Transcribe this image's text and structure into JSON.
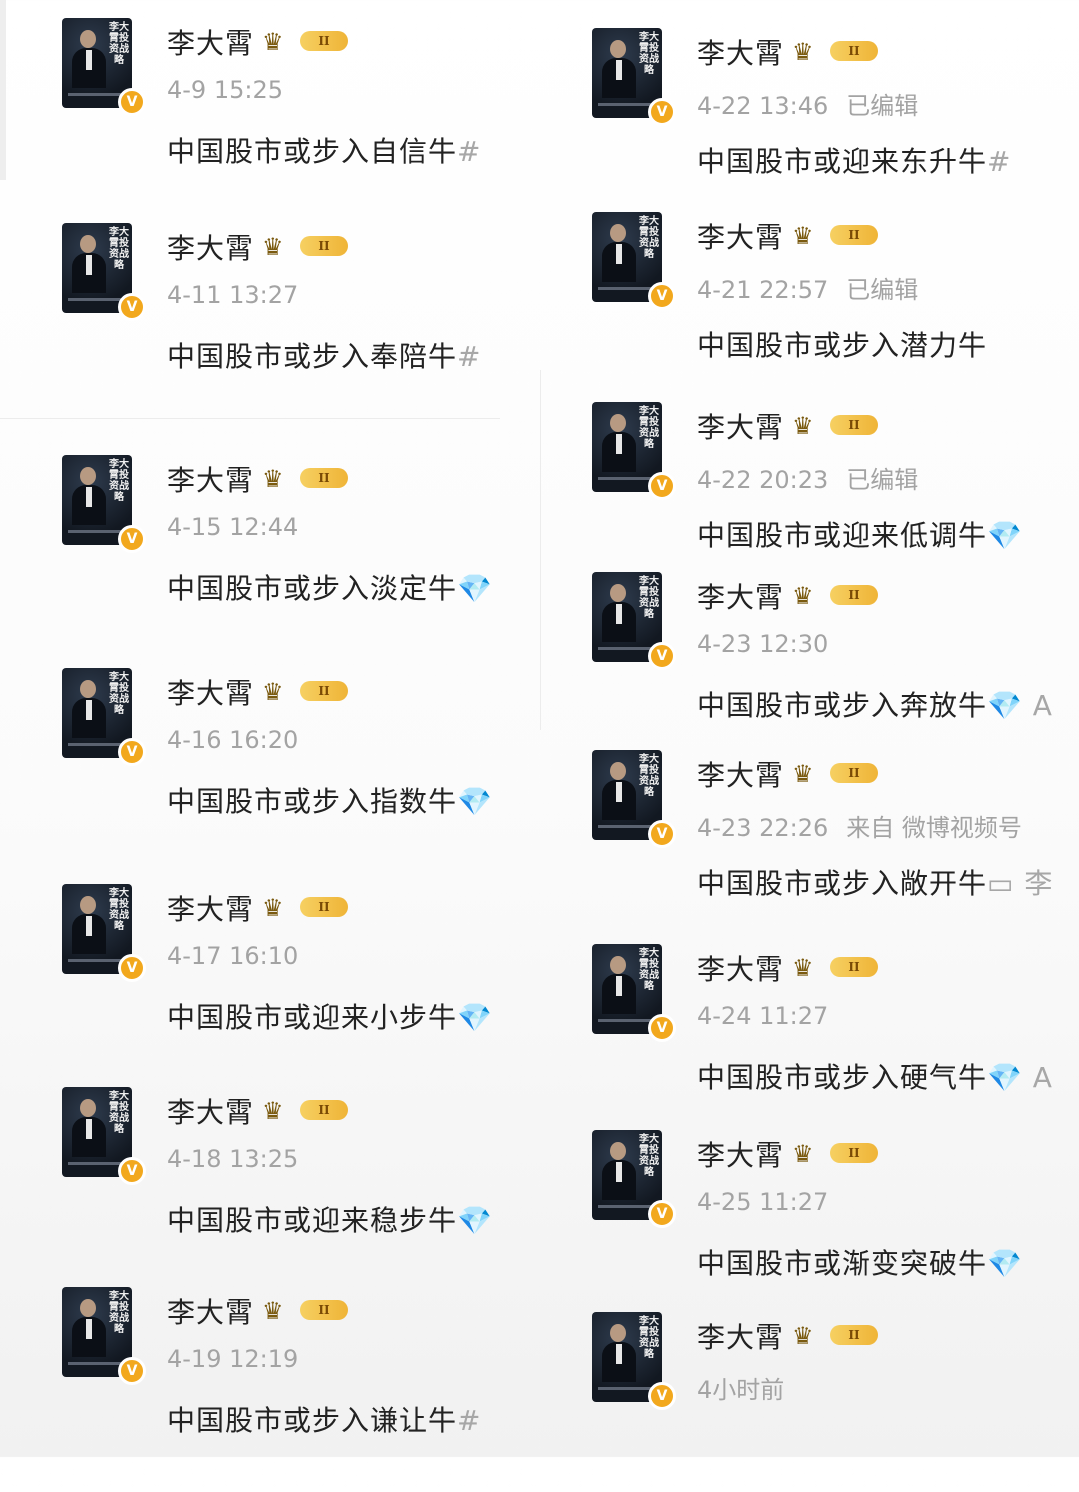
{
  "author": {
    "name": "李大霄",
    "vip_level": "II",
    "avatar_book_title": "李大霄投资战略",
    "verified_badge": "V"
  },
  "posts_left": [
    {
      "time": "4-9 15:25",
      "status": "",
      "text": "中国股市或步入自信牛",
      "tail": "#"
    },
    {
      "time": "4-11 13:27",
      "status": "",
      "text": "中国股市或步入奉陪牛",
      "tail": "#"
    },
    {
      "time": "4-15 12:44",
      "status": "",
      "text": "中国股市或步入淡定牛",
      "tail": "💎"
    },
    {
      "time": "4-16 16:20",
      "status": "",
      "text": "中国股市或步入指数牛",
      "tail": "💎"
    },
    {
      "time": "4-17 16:10",
      "status": "",
      "text": "中国股市或迎来小步牛",
      "tail": "💎"
    },
    {
      "time": "4-18 13:25",
      "status": "",
      "text": "中国股市或迎来稳步牛",
      "tail": "💎"
    },
    {
      "time": "4-19 12:19",
      "status": "",
      "text": "中国股市或步入谦让牛",
      "tail": "#"
    }
  ],
  "posts_right": [
    {
      "time": "4-22 13:46",
      "status": "已编辑",
      "text": "中国股市或迎来东升牛",
      "tail": "#"
    },
    {
      "time": "4-21 22:57",
      "status": "已编辑",
      "text": "中国股市或步入潜力牛",
      "tail": ""
    },
    {
      "time": "4-22 20:23",
      "status": "已编辑",
      "text": "中国股市或迎来低调牛",
      "tail": "💎"
    },
    {
      "time": "4-23 12:30",
      "status": "",
      "text": "中国股市或步入奔放牛",
      "tail": "💎 A"
    },
    {
      "time": "4-23 22:26",
      "status": "来自 微博视频号",
      "text": "中国股市或步入敞开牛",
      "tail": "▭ 李"
    },
    {
      "time": "4-24 11:27",
      "status": "",
      "text": "中国股市或步入硬气牛",
      "tail": "💎 A"
    },
    {
      "time": "4-25 11:27",
      "status": "",
      "text": "中国股市或渐变突破牛",
      "tail": "💎"
    },
    {
      "time": "4小时前",
      "status": "",
      "text": "",
      "tail": ""
    }
  ],
  "colors": {
    "badge": "#f2a81d",
    "vip_gold": "#efb437",
    "meta_gray": "#a3a3a3",
    "text": "#222222"
  },
  "icons": [
    "crown-icon",
    "verified-badge-icon",
    "diamond-icon",
    "video-icon"
  ]
}
